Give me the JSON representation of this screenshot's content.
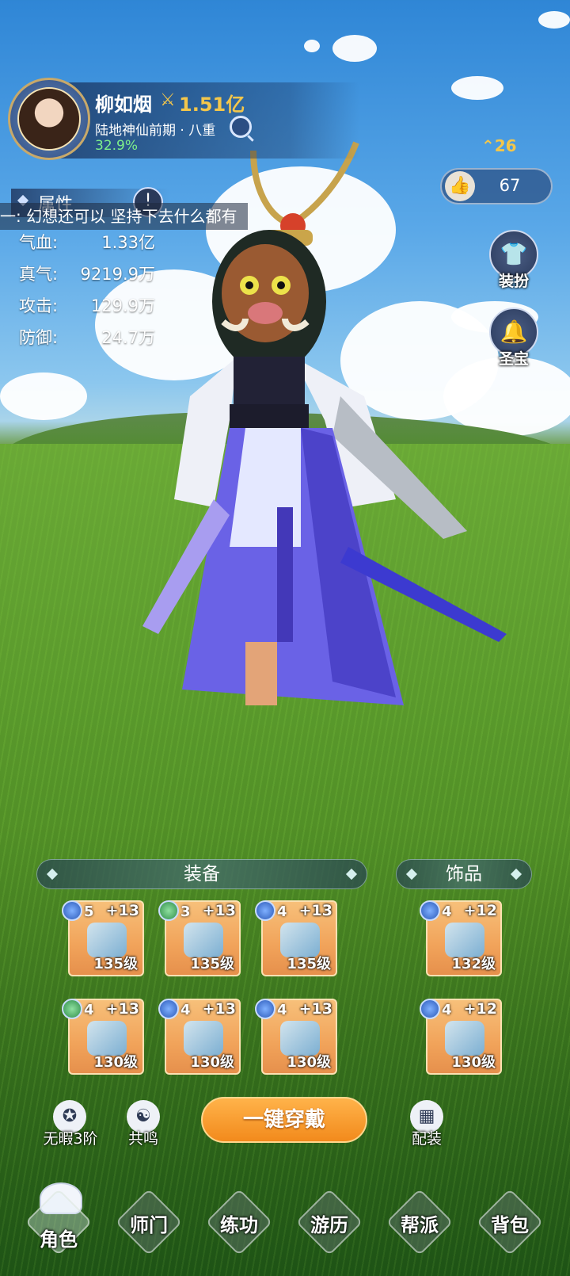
{
  "profile": {
    "name": "柳如烟",
    "power": "1.51亿",
    "realm": "陆地神仙前期 · 八重",
    "progress": "32.9%"
  },
  "attributes": {
    "title": "属性",
    "stats": [
      {
        "label": "气血:",
        "value": "1.33亿"
      },
      {
        "label": "真气:",
        "value": "9219.9万"
      },
      {
        "label": "攻击:",
        "value": "129.9万"
      },
      {
        "label": "防御:",
        "value": "24.7万"
      }
    ]
  },
  "chat": {
    "message": "一: 幻想还可以 坚持下去什么都有"
  },
  "right_panel": {
    "level": "26",
    "likes": "67",
    "buttons": [
      {
        "label": "装扮",
        "icon": "shirt-icon"
      },
      {
        "label": "圣宝",
        "icon": "bell-icon"
      }
    ]
  },
  "equipment": {
    "title": "装备",
    "slots": [
      {
        "gem": "blue",
        "stars": "5",
        "plus": "+13",
        "level": "135级",
        "icon": "sword-icon"
      },
      {
        "gem": "green",
        "stars": "3",
        "plus": "+13",
        "level": "135级",
        "icon": "belt-icon"
      },
      {
        "gem": "blue",
        "stars": "4",
        "plus": "+13",
        "level": "135级",
        "icon": "helmet-icon"
      },
      {
        "gem": "green",
        "stars": "4",
        "plus": "+13",
        "level": "130级",
        "icon": "robe-icon"
      },
      {
        "gem": "blue",
        "stars": "4",
        "plus": "+13",
        "level": "130级",
        "icon": "gauntlet-icon"
      },
      {
        "gem": "blue",
        "stars": "4",
        "plus": "+13",
        "level": "130级",
        "icon": "boots-icon"
      }
    ]
  },
  "accessories": {
    "title": "饰品",
    "slots": [
      {
        "gem": "blue",
        "stars": "4",
        "plus": "+12",
        "level": "132级",
        "icon": "ring-icon"
      },
      {
        "gem": "blue",
        "stars": "4",
        "plus": "+12",
        "level": "130级",
        "icon": "jade-pendant-icon"
      }
    ]
  },
  "actions": {
    "flawless": "无暇3阶",
    "resonance": "共鸣",
    "equip_all": "一键穿戴",
    "loadout": "配装"
  },
  "nav": [
    "角色",
    "师门",
    "练功",
    "游历",
    "帮派",
    "背包"
  ],
  "colors": {
    "gold": "#f3c64b",
    "progress_green": "#7ef08a",
    "equip_button": "#f28a1c",
    "slot_orange": "#f1a35a"
  }
}
